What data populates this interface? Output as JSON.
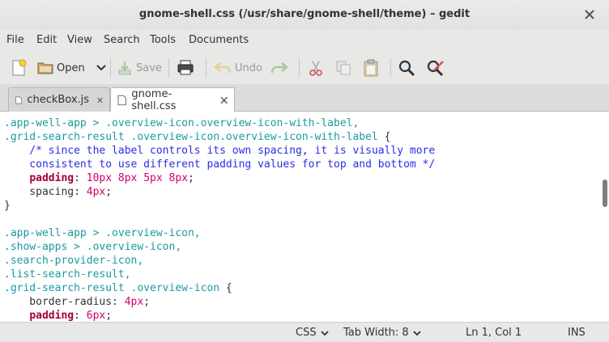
{
  "window": {
    "title": "gnome-shell.css (/usr/share/gnome-shell/theme) – gedit"
  },
  "menu": [
    "File",
    "Edit",
    "View",
    "Search",
    "Tools",
    "Documents"
  ],
  "toolbar": {
    "open": "Open",
    "save": "Save",
    "undo": "Undo"
  },
  "tabs": [
    {
      "label": "checkBox.js",
      "active": false
    },
    {
      "label": "gnome-shell.css",
      "active": true
    }
  ],
  "colors": {
    "selector": "#1a9aa0",
    "comment": "#2a2ee6",
    "value": "#d0006e",
    "property": "#a50034",
    "text": "#2e3436"
  },
  "code_lines": [
    [
      {
        "t": ".app-well-app > .overview-icon.overview-icon-with-label,",
        "c": "selector"
      }
    ],
    [
      {
        "t": ".grid-search-result .overview-icon.overview-icon-with-label",
        "c": "selector"
      },
      {
        "t": " {",
        "c": "text"
      }
    ],
    [
      {
        "t": "    /* since the label controls its own spacing, it is visually more",
        "c": "comment"
      }
    ],
    [
      {
        "t": "    consistent to use different padding values for top and bottom */",
        "c": "comment"
      }
    ],
    [
      {
        "t": "    ",
        "c": "text"
      },
      {
        "t": "padding",
        "c": "property",
        "b": true
      },
      {
        "t": ": ",
        "c": "text"
      },
      {
        "t": "10px 8px 5px 8px",
        "c": "value"
      },
      {
        "t": ";",
        "c": "text"
      }
    ],
    [
      {
        "t": "    spacing: ",
        "c": "text"
      },
      {
        "t": "4px",
        "c": "value"
      },
      {
        "t": ";",
        "c": "text"
      }
    ],
    [
      {
        "t": "}",
        "c": "text"
      }
    ],
    [
      {
        "t": "",
        "c": "text"
      }
    ],
    [
      {
        "t": ".app-well-app > .overview-icon,",
        "c": "selector"
      }
    ],
    [
      {
        "t": ".show-apps > .overview-icon,",
        "c": "selector"
      }
    ],
    [
      {
        "t": ".search-provider-icon,",
        "c": "selector"
      }
    ],
    [
      {
        "t": ".list-search-result,",
        "c": "selector"
      }
    ],
    [
      {
        "t": ".grid-search-result .overview-icon",
        "c": "selector"
      },
      {
        "t": " {",
        "c": "text"
      }
    ],
    [
      {
        "t": "    border-radius: ",
        "c": "text"
      },
      {
        "t": "4px",
        "c": "value"
      },
      {
        "t": ";",
        "c": "text"
      }
    ],
    [
      {
        "t": "    ",
        "c": "text"
      },
      {
        "t": "padding",
        "c": "property",
        "b": true
      },
      {
        "t": ": ",
        "c": "text"
      },
      {
        "t": "6px",
        "c": "value"
      },
      {
        "t": ";",
        "c": "text"
      }
    ]
  ],
  "status": {
    "language": "CSS",
    "tab_width": "Tab Width: 8",
    "position": "Ln 1, Col 1",
    "mode": "INS"
  }
}
